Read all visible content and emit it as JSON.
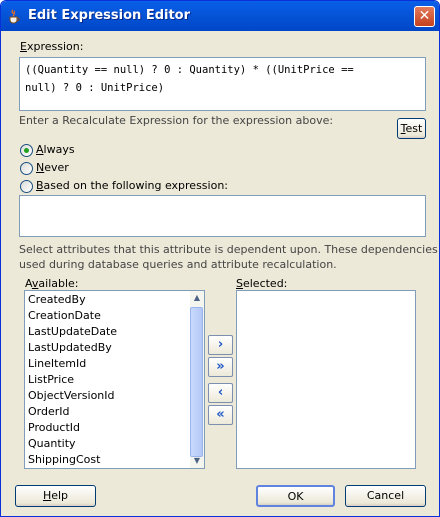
{
  "window": {
    "title": "Edit Expression Editor",
    "close_glyph": "✕"
  },
  "expression": {
    "label_underlined": "E",
    "label_rest": "xpression:",
    "value": "((Quantity == null) ? 0 : Quantity) * ((UnitPrice ==\nnull) ? 0 : UnitPrice)"
  },
  "recalc_hint": "Enter a Recalculate Expression for the expression above:",
  "test_button": {
    "u": "T",
    "rest": "est"
  },
  "radios": [
    {
      "u": "A",
      "rest": "lways",
      "checked": true
    },
    {
      "u": "N",
      "rest": "ever",
      "checked": false
    },
    {
      "u": "B",
      "rest": "ased on the following expression:",
      "checked": false
    }
  ],
  "dependency_text": {
    "line1": "Select attributes that this attribute is dependent upon. These dependencies are",
    "line2": "used during database queries and attribute recalculation."
  },
  "available": {
    "label_pre": "A",
    "label_u": "v",
    "label_rest": "ailable:",
    "items": [
      "CreatedBy",
      "CreationDate",
      "LastUpdateDate",
      "LastUpdatedBy",
      "LineItemId",
      "ListPrice",
      "ObjectVersionId",
      "OrderId",
      "ProductId",
      "Quantity",
      "ShippingCost"
    ]
  },
  "selected": {
    "u": "S",
    "rest": "elected:"
  },
  "move_buttons": {
    "add": "›",
    "add_all": "»",
    "remove": "‹",
    "remove_all": "«"
  },
  "scroll_glyphs": {
    "up": "▲",
    "down": "▼"
  },
  "buttons": {
    "help": {
      "u": "H",
      "rest": "elp"
    },
    "ok": "OK",
    "cancel": "Cancel"
  }
}
